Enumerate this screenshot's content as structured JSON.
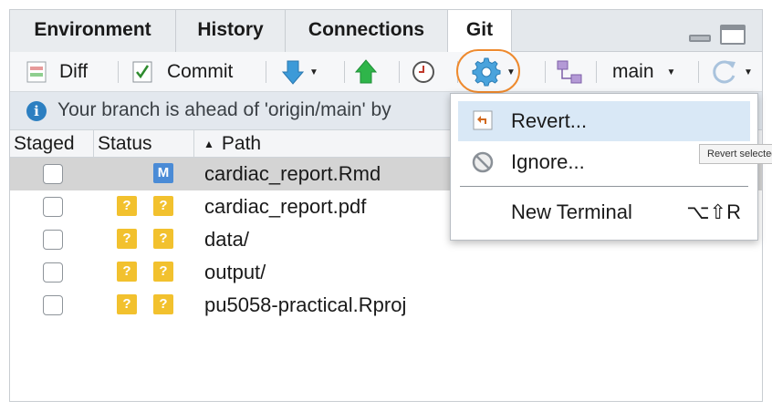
{
  "tabs": [
    {
      "label": "Environment"
    },
    {
      "label": "History"
    },
    {
      "label": "Connections"
    },
    {
      "label": "Git",
      "active": true
    }
  ],
  "toolbar": {
    "diff_label": "Diff",
    "commit_label": "Commit",
    "branch_label": "main"
  },
  "info": {
    "message": "Your branch is ahead of 'origin/main' by"
  },
  "table": {
    "columns": [
      "Staged",
      "Status",
      "Path"
    ],
    "rows": [
      {
        "staged": false,
        "status": [
          "M"
        ],
        "path": "cardiac_report.Rmd",
        "selected": true
      },
      {
        "staged": false,
        "status": [
          "?",
          "?"
        ],
        "path": "cardiac_report.pdf"
      },
      {
        "staged": false,
        "status": [
          "?",
          "?"
        ],
        "path": "data/"
      },
      {
        "staged": false,
        "status": [
          "?",
          "?"
        ],
        "path": "output/"
      },
      {
        "staged": false,
        "status": [
          "?",
          "?"
        ],
        "path": "pu5058-practical.Rproj"
      }
    ]
  },
  "menu": {
    "items": [
      {
        "label": "Revert...",
        "icon": "revert-icon",
        "highlighted": true
      },
      {
        "label": "Ignore...",
        "icon": "ignore-icon"
      },
      {
        "label": "New Terminal",
        "shortcut": "⌥⇧R"
      }
    ]
  },
  "tooltip": {
    "text": "Revert selected"
  },
  "colors": {
    "accent_orange": "#ee8a2e",
    "status_untracked": "#f2c12e",
    "status_modified": "#4a8bd6",
    "menu_highlight": "#d9e8f6",
    "selected_row": "#d4d4d4"
  }
}
